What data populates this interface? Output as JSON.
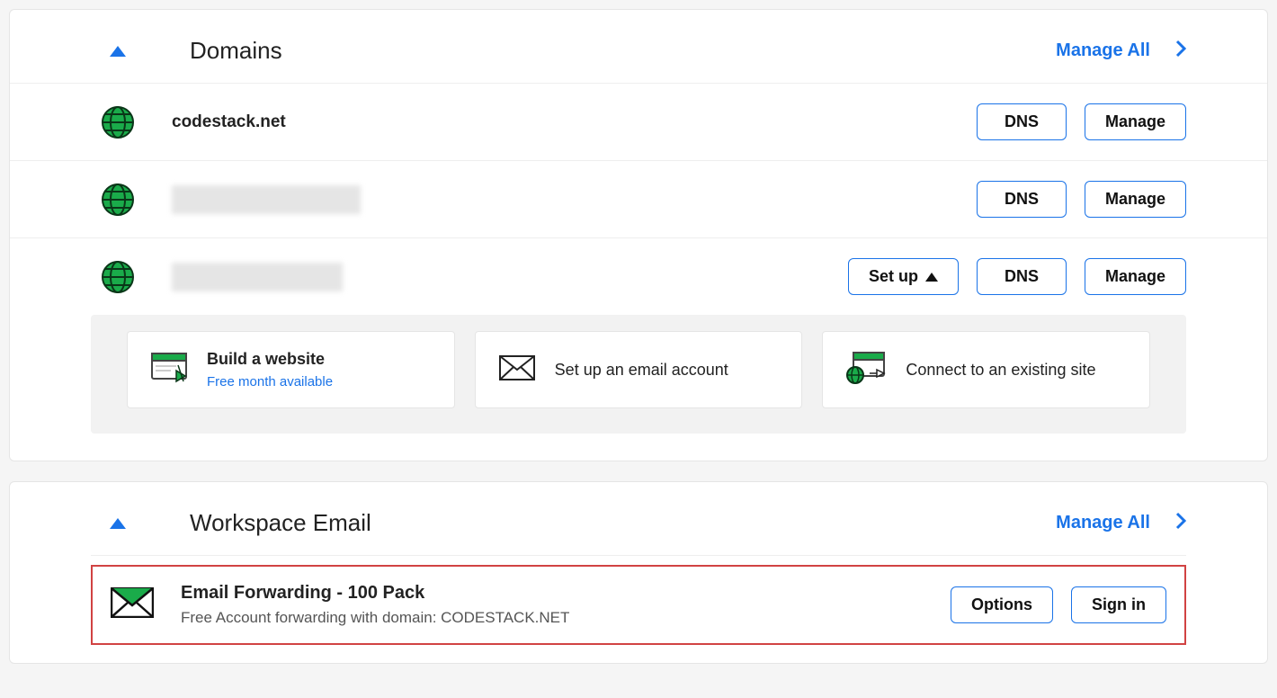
{
  "domains": {
    "title": "Domains",
    "manage_all": "Manage All",
    "items": [
      {
        "name": "codestack.net",
        "blurred": false,
        "setup": false
      },
      {
        "name": "",
        "blurred": true,
        "blur_class": "blur-a",
        "setup": false
      },
      {
        "name": "",
        "blurred": true,
        "blur_class": "blur-b",
        "setup": true
      }
    ],
    "buttons": {
      "dns": "DNS",
      "manage": "Manage",
      "setup": "Set up"
    },
    "cards": [
      {
        "icon": "build-site-icon",
        "title": "Build a website",
        "sub": "Free month available"
      },
      {
        "icon": "envelope-icon",
        "title": "Set up an email account",
        "sub": ""
      },
      {
        "icon": "connect-site-icon",
        "title": "Connect to an existing site",
        "sub": ""
      }
    ]
  },
  "workspace": {
    "title": "Workspace Email",
    "manage_all": "Manage All",
    "item": {
      "title": "Email Forwarding - 100 Pack",
      "sub": "Free Account forwarding with domain: CODESTACK.NET"
    },
    "buttons": {
      "options": "Options",
      "signin": "Sign in"
    }
  }
}
